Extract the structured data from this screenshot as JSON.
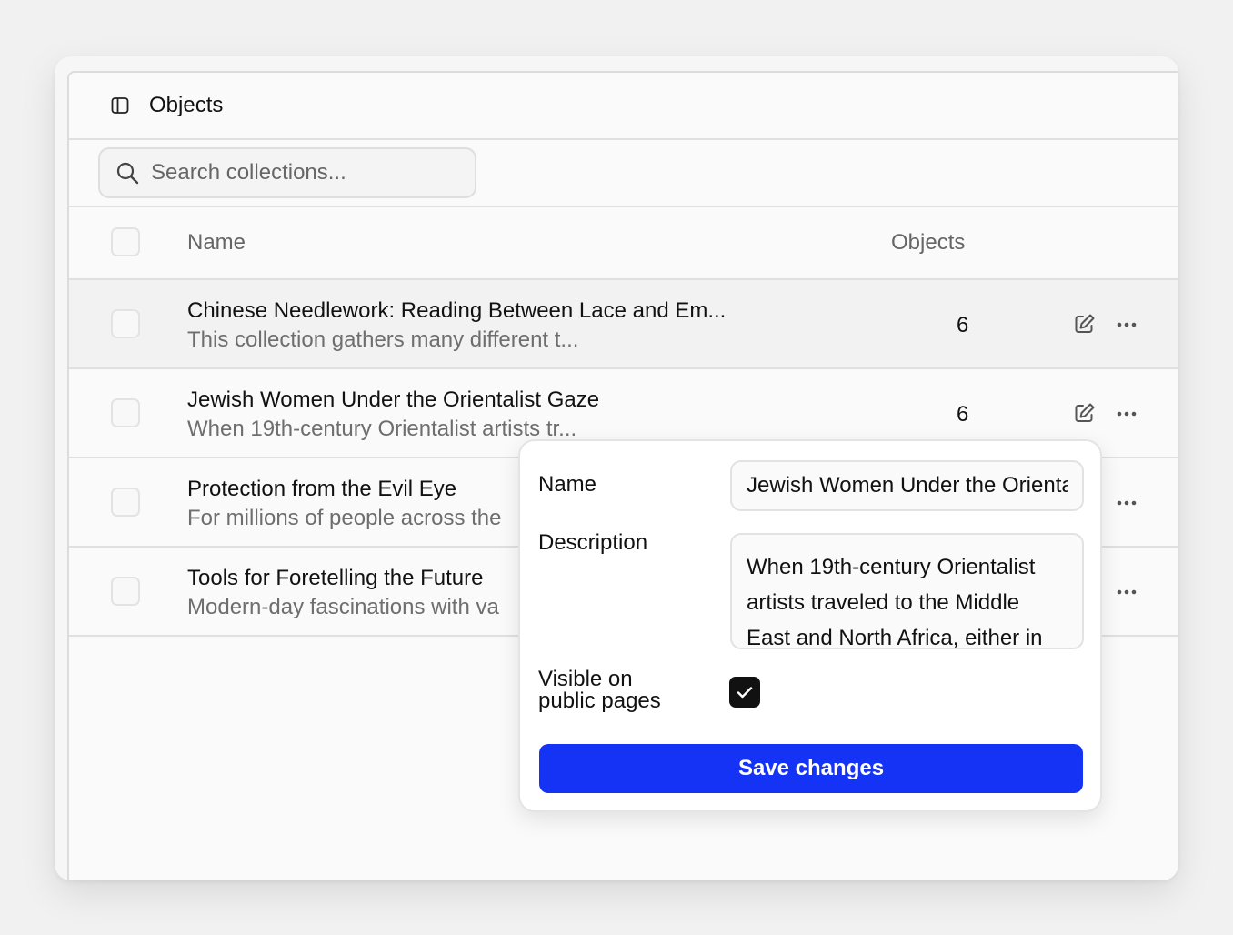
{
  "header": {
    "title": "Objects",
    "toggle_icon": "sidebar-toggle-icon"
  },
  "search": {
    "placeholder": "Search collections...",
    "value": ""
  },
  "table": {
    "columns": {
      "name": "Name",
      "objects": "Objects"
    },
    "rows": [
      {
        "title": "Chinese Needlework: Reading Between Lace and Em...",
        "description": "This collection gathers many different t...",
        "count": "6"
      },
      {
        "title": "Jewish Women Under the Orientalist Gaze",
        "description": "When 19th-century Orientalist artists tr...",
        "count": "6"
      },
      {
        "title": "Protection from the Evil Eye",
        "description": "For millions of people across the",
        "count": ""
      },
      {
        "title": "Tools for Foretelling the Future",
        "description": "Modern-day fascinations with va",
        "count": ""
      }
    ]
  },
  "popover": {
    "name_label": "Name",
    "name_value": "Jewish Women Under the Orientalist Gaze",
    "description_label": "Description",
    "description_value": "When 19th-century Orientalist artists traveled to the Middle East and North Africa, either in",
    "visible_label_line1": "Visible on",
    "visible_label_line2": "public pages",
    "visible_checked": true,
    "save_label": "Save changes"
  },
  "colors": {
    "accent": "#1433f5",
    "text_muted": "#6e6e6e",
    "border": "#e0e0e0"
  }
}
